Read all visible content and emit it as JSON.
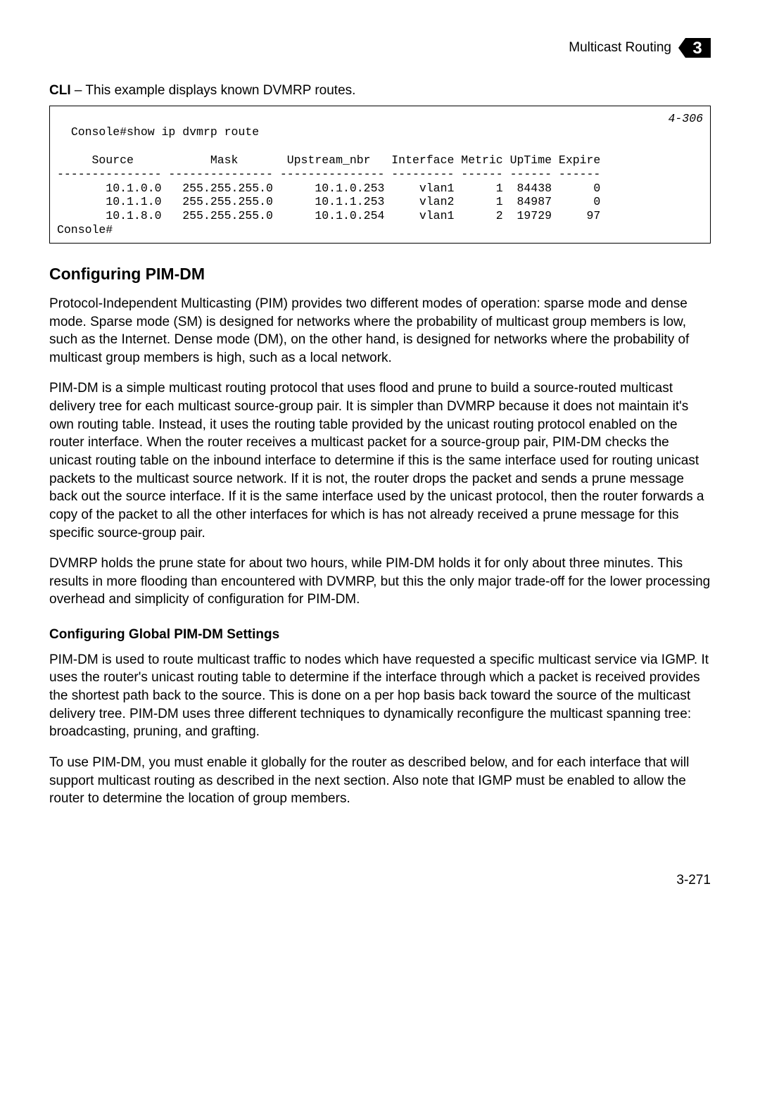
{
  "header": {
    "section_title": "Multicast Routing",
    "chapter_number": "3"
  },
  "cli_intro_bold": "CLI",
  "cli_intro_text": " – This example displays known DVMRP routes.",
  "code_ref": "4-306",
  "code_block": "Console#show ip dvmrp route\n\n     Source           Mask       Upstream_nbr   Interface Metric UpTime Expire\n--------------- --------------- --------------- --------- ------ ------ ------\n       10.1.0.0   255.255.255.0      10.1.0.253     vlan1      1  84438      0\n       10.1.1.0   255.255.255.0      10.1.1.253     vlan2      1  84987      0\n       10.1.8.0   255.255.255.0      10.1.0.254     vlan1      2  19729     97\nConsole#",
  "h2_configuring_pimdm": "Configuring PIM-DM",
  "p1": "Protocol-Independent Multicasting (PIM) provides two different modes of operation: sparse mode and dense mode. Sparse mode (SM) is designed for networks where the probability of multicast group members is low, such as the Internet. Dense mode (DM), on the other hand, is designed for networks where the probability of multicast group members is high, such as a local network.",
  "p2": "PIM-DM is a simple multicast routing protocol that uses flood and prune to build a source-routed multicast delivery tree for each multicast source-group pair. It is simpler than DVMRP because it does not maintain it's own routing table. Instead, it uses the routing table provided by the unicast routing protocol enabled on the router interface. When the router receives a multicast packet for a source-group pair, PIM-DM checks the unicast routing table on the inbound interface to determine if this is the same interface used for routing unicast packets to the multicast source network. If it is not, the router drops the packet and sends a prune message back out the source interface. If it is the same interface used by the unicast protocol, then the router forwards a copy of the packet to all the other interfaces for which is has not already received a prune message for this specific source-group pair.",
  "p3": "DVMRP holds the prune state for about two hours, while PIM-DM holds it for only about three minutes. This results in more flooding than encountered with DVMRP, but this the only major trade-off for the lower processing overhead and simplicity of configuration for PIM-DM.",
  "h3_global_settings": "Configuring Global PIM-DM Settings",
  "p4": "PIM-DM is used to route multicast traffic to nodes which have requested a specific multicast service via IGMP. It uses the router's unicast routing table to determine if the interface through which a packet is received provides the shortest path back to the source. This is done on a per hop basis back toward the source of the multicast delivery tree. PIM-DM uses three different techniques to dynamically reconfigure the multicast spanning tree: broadcasting, pruning, and grafting.",
  "p5": "To use PIM-DM, you must enable it globally for the router as described below, and for each interface that will support multicast routing as described in the next section. Also note that IGMP must be enabled to allow the router to determine the location of group members.",
  "page_number": "3-271"
}
